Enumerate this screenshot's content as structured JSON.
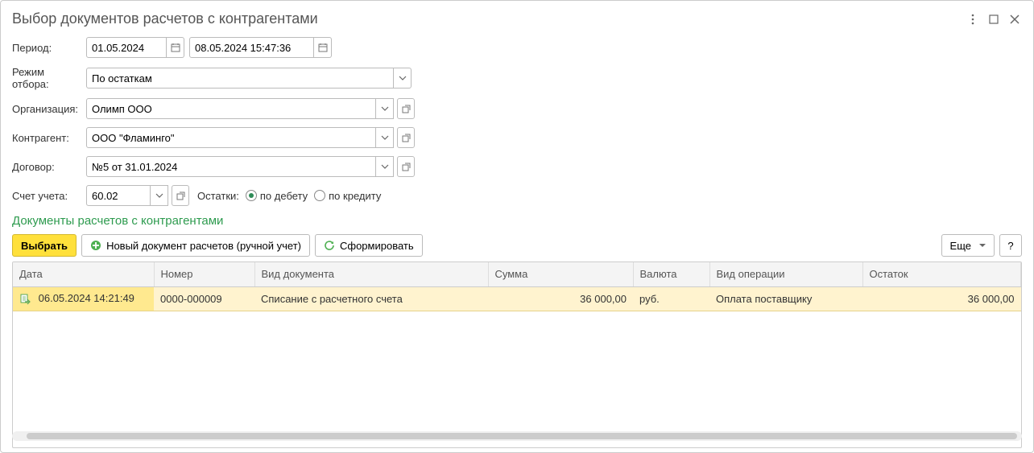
{
  "window": {
    "title": "Выбор документов расчетов с контрагентами"
  },
  "form": {
    "period_label": "Период:",
    "date_from": "01.05.2024",
    "date_to": "08.05.2024 15:47:36",
    "filter_mode_label": "Режим отбора:",
    "filter_mode_value": "По остаткам",
    "org_label": "Организация:",
    "org_value": "Олимп ООО",
    "counterparty_label": "Контрагент:",
    "counterparty_value": "ООО \"Фламинго\"",
    "contract_label": "Договор:",
    "contract_value": "№5 от 31.01.2024",
    "account_label": "Счет учета:",
    "account_value": "60.02",
    "balances_label": "Остатки:",
    "radio_debit": "по дебету",
    "radio_credit": "по кредиту"
  },
  "section": {
    "heading": "Документы расчетов с контрагентами"
  },
  "toolbar": {
    "select": "Выбрать",
    "new_doc": "Новый документ расчетов (ручной учет)",
    "generate": "Сформировать",
    "more": "Еще",
    "help": "?"
  },
  "table": {
    "headers": {
      "date": "Дата",
      "number": "Номер",
      "doc_type": "Вид документа",
      "sum": "Сумма",
      "currency": "Валюта",
      "op_type": "Вид операции",
      "balance": "Остаток"
    },
    "rows": [
      {
        "date": "06.05.2024 14:21:49",
        "number": "0000-000009",
        "doc_type": "Списание с расчетного счета",
        "sum": "36 000,00",
        "currency": "руб.",
        "op_type": "Оплата поставщику",
        "balance": "36 000,00"
      }
    ]
  }
}
